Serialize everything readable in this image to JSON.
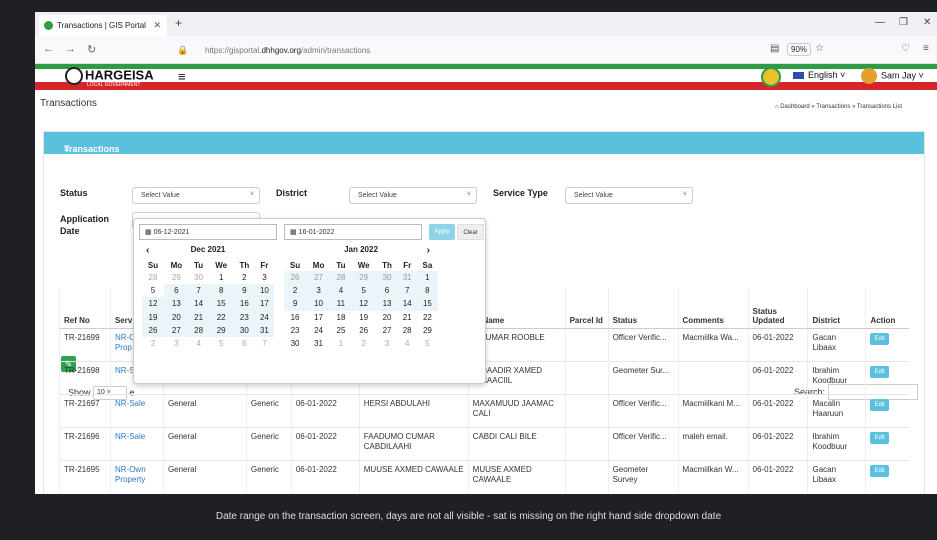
{
  "browser": {
    "tab_title": "Transactions | GIS Portal",
    "url_prefix": "https://gisportal.",
    "url_domain": "dhhgov.org",
    "url_path": "/admin/transactions",
    "zoom": "90%"
  },
  "header": {
    "logo": "HARGEISA",
    "logo_sub": "LOCAL GOVERNMENT",
    "language": "English",
    "user": "Sam Jay"
  },
  "page": {
    "title": "Transactions",
    "breadcrumb": "Dashboard » Transactions » Transactions List",
    "panel_title": "Transactions List"
  },
  "filters": {
    "status_label": "Status",
    "status_value": "Select Value",
    "district_label": "District",
    "district_value": "Select Value",
    "service_label": "Service Type",
    "service_value": "Select Value",
    "app_date_label_1": "Application",
    "app_date_label_2": "Date"
  },
  "list_controls": {
    "show_label": "Show",
    "show_value": "10",
    "search_label": "Search:"
  },
  "datepicker": {
    "start": "06-12-2021",
    "end": "16-01-2022",
    "apply": "Apply",
    "clear": "Clear",
    "left_month": "Dec 2021",
    "right_month": "Jan 2022",
    "weekdays_left": [
      "Su",
      "Mo",
      "Tu",
      "We",
      "Th",
      "Fr"
    ],
    "weekdays_right": [
      "Su",
      "Mo",
      "Tu",
      "We",
      "Th",
      "Fr",
      "Sa"
    ],
    "left_weeks": [
      [
        "28",
        "29",
        "30",
        "1",
        "2",
        "3"
      ],
      [
        "5",
        "6",
        "7",
        "8",
        "9",
        "10"
      ],
      [
        "12",
        "13",
        "14",
        "15",
        "16",
        "17"
      ],
      [
        "19",
        "20",
        "21",
        "22",
        "23",
        "24"
      ],
      [
        "26",
        "27",
        "28",
        "29",
        "30",
        "31"
      ],
      [
        "2",
        "3",
        "4",
        "5",
        "6",
        "7"
      ]
    ],
    "right_weeks": [
      [
        "26",
        "27",
        "28",
        "29",
        "30",
        "31",
        "1"
      ],
      [
        "2",
        "3",
        "4",
        "5",
        "6",
        "7",
        "8"
      ],
      [
        "9",
        "10",
        "11",
        "12",
        "13",
        "14",
        "15"
      ],
      [
        "16",
        "17",
        "18",
        "19",
        "20",
        "21",
        "22"
      ],
      [
        "23",
        "24",
        "25",
        "26",
        "27",
        "28",
        "29"
      ],
      [
        "30",
        "31",
        "1",
        "2",
        "3",
        "4",
        "5"
      ]
    ]
  },
  "table": {
    "headers": [
      "Ref No",
      "Serv",
      "",
      "",
      "",
      "",
      "er Name",
      "Parcel Id",
      "Status",
      "Comments",
      "Status Updated",
      "District",
      "Action"
    ],
    "rows": [
      [
        "TR-21699",
        "NR-Own Prop",
        "",
        "",
        "",
        "",
        "A CUMAR ROOBLE",
        "",
        "Officer Verific...",
        "Macmiilka Wa...",
        "06-01-2022",
        "Gacan Libaax",
        "Edit"
      ],
      [
        "TR-21698",
        "NR-S",
        "",
        "",
        "",
        "",
        "DIQAADIR XAMED ISMAACIIL",
        "",
        "Geometer Sur...",
        "",
        "06-01-2022",
        "Ibrahim Koodbuur",
        "Edit"
      ],
      [
        "TR-21697",
        "NR-Sale",
        "General",
        "Generic",
        "06-01-2022",
        "HERSI ABDULAHI",
        "MAXAMUUD JAAMAC CALI",
        "",
        "Officer Verific...",
        "Macmiilkani M...",
        "06-01-2022",
        "Macalin Haaruun",
        "Edit"
      ],
      [
        "TR-21696",
        "NR-Sale",
        "General",
        "Generic",
        "06-01-2022",
        "FAADUMO CUMAR CABDILAAHI",
        "CABDI CALI BILE",
        "",
        "Officer Verific...",
        "maleh email.",
        "06-01-2022",
        "Ibrahim Koodbuur",
        "Edit"
      ],
      [
        "TR-21695",
        "NR-Own Property",
        "General",
        "Generic",
        "06-01-2022",
        "MUUSE AXMED CAWAALE",
        "MUUSE AXMED CAWAALE",
        "",
        "Geometer Survey",
        "Macmiilkan W...",
        "06-01-2022",
        "Gacan Libaax",
        "Edit"
      ]
    ]
  },
  "caption": "Date range on the transaction screen, days are not all visible - sat is missing on the right hand side dropdown date"
}
